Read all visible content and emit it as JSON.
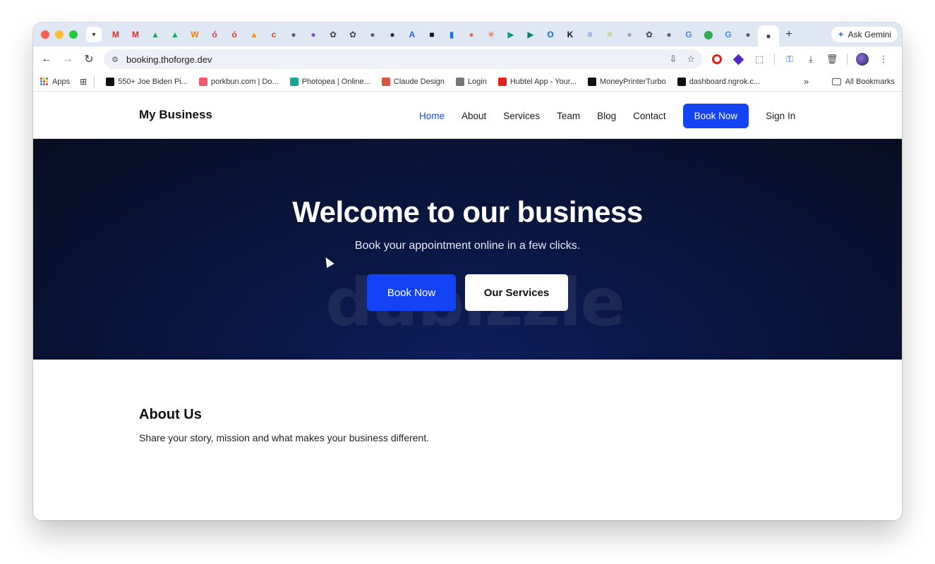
{
  "browser": {
    "tab_favicons": [
      {
        "name": "gmail-icon",
        "color": "#d93025",
        "glyph": "M"
      },
      {
        "name": "gmail-icon",
        "color": "#d93025",
        "glyph": "M"
      },
      {
        "name": "drive-icon",
        "color": "#1fa463",
        "glyph": "▲"
      },
      {
        "name": "drive-icon",
        "color": "#1fa463",
        "glyph": "▲"
      },
      {
        "name": "w-icon",
        "color": "#f57c00",
        "glyph": "W"
      },
      {
        "name": "opera-tab-icon",
        "color": "#e53935",
        "glyph": "ó"
      },
      {
        "name": "opera-tab-icon",
        "color": "#e53935",
        "glyph": "ó"
      },
      {
        "name": "pma-icon",
        "color": "#f39c12",
        "glyph": "▲"
      },
      {
        "name": "cp-icon",
        "color": "#e64a19",
        "glyph": "c"
      },
      {
        "name": "globe-icon",
        "color": "#5f6368",
        "glyph": "●"
      },
      {
        "name": "purple-icon",
        "color": "#7e57c2",
        "glyph": "●"
      },
      {
        "name": "openai-icon",
        "color": "#444444",
        "glyph": "✿"
      },
      {
        "name": "openai-icon",
        "color": "#444444",
        "glyph": "✿"
      },
      {
        "name": "globe-icon",
        "color": "#5f6368",
        "glyph": "●"
      },
      {
        "name": "github-icon",
        "color": "#24292f",
        "glyph": "●"
      },
      {
        "name": "api-icon",
        "color": "#3367d6",
        "glyph": "A"
      },
      {
        "name": "dark-app-icon",
        "color": "#111111",
        "glyph": "■"
      },
      {
        "name": "analytics-icon",
        "color": "#1a73e8",
        "glyph": "▮"
      },
      {
        "name": "orange-circle-icon",
        "color": "#ef6c4f",
        "glyph": "●"
      },
      {
        "name": "claude-icon",
        "color": "#d9583b",
        "glyph": "✳"
      },
      {
        "name": "play-icon",
        "color": "#00a173",
        "glyph": "▶"
      },
      {
        "name": "play-console-icon",
        "color": "#01875f",
        "glyph": "▶"
      },
      {
        "name": "outlook-icon",
        "color": "#0f6cbd",
        "glyph": "O"
      },
      {
        "name": "k-icon",
        "color": "#111111",
        "glyph": "K"
      },
      {
        "name": "docs-icon",
        "color": "#4285f4",
        "glyph": "≡"
      },
      {
        "name": "x-icon",
        "color": "#b7d44b",
        "glyph": "✕"
      },
      {
        "name": "grey-globe-icon",
        "color": "#9aa0a6",
        "glyph": "●"
      },
      {
        "name": "openai-icon",
        "color": "#444444",
        "glyph": "✿"
      },
      {
        "name": "globe-icon",
        "color": "#5f6368",
        "glyph": "●"
      },
      {
        "name": "google-icon",
        "color": "#4285f4",
        "glyph": "G"
      },
      {
        "name": "maps-icon",
        "color": "#34a853",
        "glyph": "⬤"
      },
      {
        "name": "google-icon",
        "color": "#4285f4",
        "glyph": "G"
      },
      {
        "name": "globe-icon",
        "color": "#5f6368",
        "glyph": "●"
      }
    ],
    "new_tab_label": "+",
    "gemini_label": "Ask Gemini",
    "url": "booking.thoforge.dev"
  },
  "bookmarks": [
    {
      "label": "Apps",
      "icon": "apps-grid-icon"
    },
    {
      "label": "550+ Joe Biden Pi...",
      "icon": "unsplash-icon",
      "color": "#111111"
    },
    {
      "label": "porkbun.com | Do...",
      "icon": "porkbun-icon",
      "color": "#ef5b6b"
    },
    {
      "label": "Photopea | Online...",
      "icon": "photopea-icon",
      "color": "#18a497"
    },
    {
      "label": "Claude Design",
      "icon": "claude-design-icon",
      "color": "#d9583b"
    },
    {
      "label": "Login",
      "icon": "login-icon",
      "color": "#777777"
    },
    {
      "label": "Hubtel App - Your...",
      "icon": "hubtel-icon",
      "color": "#e2231a"
    },
    {
      "label": "MoneyPrinterTurbo",
      "icon": "notion-icon",
      "color": "#111111"
    },
    {
      "label": "dashboard.ngrok.c...",
      "icon": "ngrok-icon",
      "color": "#111111"
    }
  ],
  "bookmarks_more": "»",
  "bookmarks_all": "All Bookmarks",
  "site": {
    "brand": "My Business",
    "nav": {
      "home": "Home",
      "about": "About",
      "services": "Services",
      "team": "Team",
      "blog": "Blog",
      "contact": "Contact",
      "book_now": "Book Now",
      "sign_in": "Sign In"
    },
    "hero": {
      "title": "Welcome to our business",
      "subtitle": "Book your appointment online in a few clicks.",
      "primary_button": "Book Now",
      "secondary_button": "Our Services",
      "watermark": "dubizzle"
    },
    "about": {
      "title": "About Us",
      "text": "Share your story, mission and what makes your business different."
    }
  },
  "colors": {
    "accent": "#1343f5",
    "nav_active": "#1a49e6",
    "hero_bg": "#09163f"
  }
}
